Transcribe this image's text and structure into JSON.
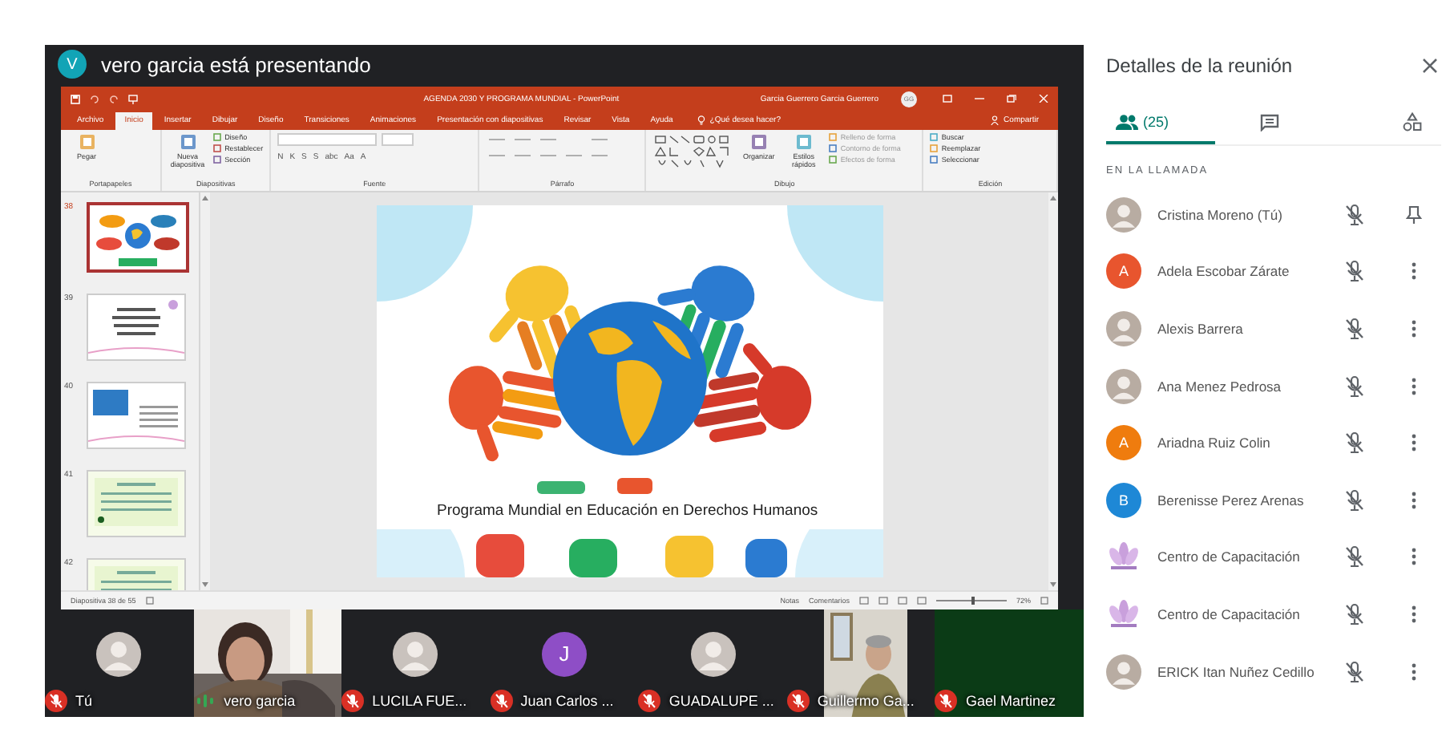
{
  "presenter": {
    "initial": "V",
    "text": "vero garcia está presentando"
  },
  "powerpoint": {
    "title": "AGENDA 2030 Y PROGRAMA MUNDIAL - PowerPoint",
    "user": "Garcia Guerrero Garcia Guerrero",
    "user_initials": "GG",
    "ribbon_tabs": [
      {
        "label": "Archivo",
        "selected": false
      },
      {
        "label": "Inicio",
        "selected": true
      },
      {
        "label": "Insertar",
        "selected": false
      },
      {
        "label": "Dibujar",
        "selected": false
      },
      {
        "label": "Diseño",
        "selected": false
      },
      {
        "label": "Transiciones",
        "selected": false
      },
      {
        "label": "Animaciones",
        "selected": false
      },
      {
        "label": "Presentación con diapositivas",
        "selected": false
      },
      {
        "label": "Revisar",
        "selected": false
      },
      {
        "label": "Vista",
        "selected": false
      },
      {
        "label": "Ayuda",
        "selected": false
      }
    ],
    "tell_me": "¿Qué desea hacer?",
    "share": "Compartir",
    "groups": [
      {
        "label": "Portapapeles",
        "items": [
          {
            "kind": "big",
            "label": "Pegar"
          }
        ]
      },
      {
        "label": "Diapositivas",
        "items": [
          {
            "kind": "big",
            "label": "Nueva diapositiva"
          },
          {
            "kind": "small",
            "label": "Diseño"
          },
          {
            "kind": "small",
            "label": "Restablecer"
          },
          {
            "kind": "small",
            "label": "Sección"
          }
        ]
      },
      {
        "label": "Fuente",
        "items": [
          {
            "kind": "letter",
            "label": "N"
          },
          {
            "kind": "letter",
            "label": "K"
          },
          {
            "kind": "letter",
            "label": "S"
          },
          {
            "kind": "letter",
            "label": "S"
          },
          {
            "kind": "letter",
            "label": "abc"
          },
          {
            "kind": "letter",
            "label": "Aa"
          },
          {
            "kind": "letter",
            "label": "A"
          }
        ]
      },
      {
        "label": "Párrafo"
      },
      {
        "label": "Dibujo",
        "items": [
          {
            "kind": "big",
            "label": "Organizar"
          },
          {
            "kind": "big",
            "label": "Estilos rápidos"
          },
          {
            "kind": "small",
            "label": "Relleno de forma"
          },
          {
            "kind": "small",
            "label": "Contorno de forma"
          },
          {
            "kind": "small",
            "label": "Efectos de forma"
          }
        ]
      },
      {
        "label": "Edición",
        "items": [
          {
            "kind": "small",
            "label": "Buscar"
          },
          {
            "kind": "small",
            "label": "Reemplazar"
          },
          {
            "kind": "small",
            "label": "Seleccionar"
          }
        ]
      }
    ],
    "thumbnails": [
      {
        "number": "38",
        "selected": true,
        "kind": "hands"
      },
      {
        "number": "39",
        "selected": false,
        "kind": "text"
      },
      {
        "number": "40",
        "selected": false
      },
      {
        "number": "41",
        "selected": false,
        "kind": "green"
      },
      {
        "number": "42",
        "selected": false,
        "kind": "green"
      }
    ],
    "slide_title": "Programa Mundial en Educación en Derechos Humanos",
    "status": "Diapositiva 38 de 55",
    "notes": "Notas",
    "comments": "Comentarios",
    "zoom": "72%",
    "zoom_slider": {
      "level": 0.5
    }
  },
  "tiles": [
    {
      "name": "Tú",
      "kind": "avatar",
      "muted": true
    },
    {
      "name": "vero garcia",
      "kind": "video",
      "muted": false
    },
    {
      "name": "LUCILA FUE...",
      "kind": "avatar",
      "muted": true
    },
    {
      "name": "Juan Carlos ...",
      "kind": "letter",
      "letter": "J",
      "color": "#8e4ec6",
      "muted": true
    },
    {
      "name": "GUADALUPE ...",
      "kind": "avatar",
      "muted": true
    },
    {
      "name": "Guillermo Ga...",
      "kind": "video2",
      "muted": true
    },
    {
      "name": "Gael Martinez",
      "kind": "plain",
      "muted": true
    }
  ],
  "panel": {
    "title": "Detalles de la reunión",
    "tabs": [
      {
        "kind": "people",
        "label": "(25)",
        "selected": true
      },
      {
        "kind": "chat",
        "selected": false
      },
      {
        "kind": "activities",
        "selected": false
      }
    ],
    "section": "EN LA LLAMADA",
    "participants": [
      {
        "name": "Cristina Moreno (Tú)",
        "muted": true,
        "pinned": true
      },
      {
        "name": "Adela Escobar Zárate",
        "kind": "letter",
        "letter": "A",
        "color": "#e8552e",
        "muted": true,
        "pinned": false
      },
      {
        "name": "Alexis Barrera",
        "muted": true,
        "pinned": false
      },
      {
        "name": "Ana Menez Pedrosa",
        "muted": true,
        "pinned": false
      },
      {
        "name": "Ariadna Ruiz Colin",
        "kind": "letter",
        "letter": "A",
        "color": "#ef7c0e",
        "muted": true,
        "pinned": false
      },
      {
        "name": "Berenisse Perez Arenas",
        "kind": "letter",
        "letter": "B",
        "color": "#1e88d6",
        "muted": true,
        "pinned": false
      },
      {
        "name": "Centro de Capacitación",
        "kind": "logo",
        "muted": true,
        "pinned": false
      },
      {
        "name": "Centro de Capacitación",
        "kind": "logo",
        "muted": true,
        "pinned": false
      },
      {
        "name": "ERICK Itan Nuñez Cedillo",
        "muted": true,
        "pinned": false
      }
    ]
  }
}
